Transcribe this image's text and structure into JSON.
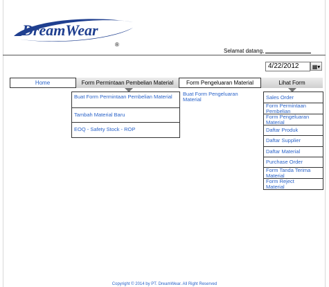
{
  "brand": {
    "name": "DreamWear",
    "registered": "®"
  },
  "header": {
    "greeting": "Selamat datang,"
  },
  "date": {
    "value": "4/22/2012"
  },
  "nav": {
    "home": "Home",
    "permintaan": "Form Permintaan Pembelian Material",
    "pengeluaran": "Form Pengeluaran Material",
    "lihat": "Lihat Form"
  },
  "menu_permintaan": [
    "Buat Form Permintaan Pembelian Material",
    "Tambah Material Baru",
    "EOQ - Safety Stock - ROP"
  ],
  "menu_pengeluaran": [
    "Buat Form Pengeluaran Material"
  ],
  "menu_lihat": [
    "Sales Order",
    "Form Permintaan Pembelian",
    "Form Pengeluaran Material",
    "Daftar Produk",
    "Daftar Supplier",
    "Daftar Material",
    "Purchase Order",
    "Form Tanda Terima Material",
    "Form Reject Material"
  ],
  "footer": {
    "text": "Copyright © 2014 by PT. DreamWear. All Right Reserved"
  },
  "colors": {
    "link": "#2a63c9",
    "logo": "#1f3f8f"
  }
}
